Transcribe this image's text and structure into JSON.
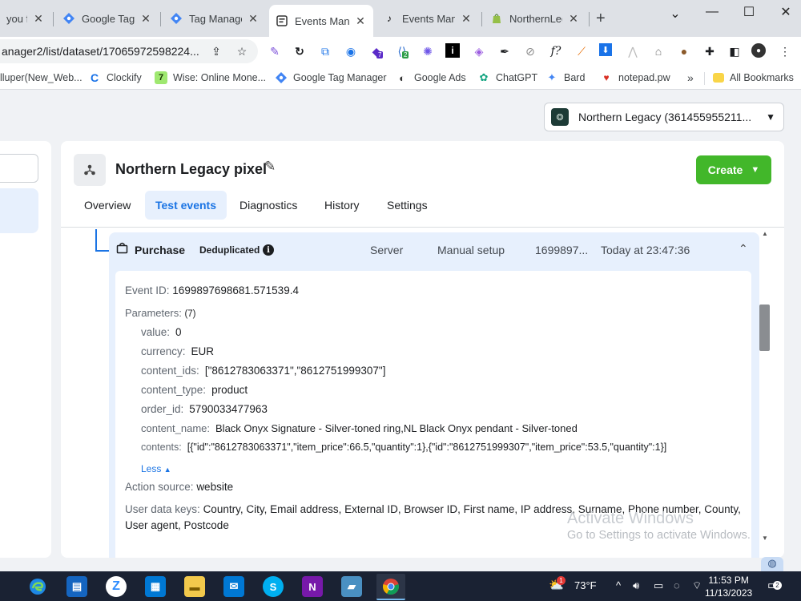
{
  "browser": {
    "tabs": [
      {
        "title": "you fo",
        "icon": "generic-page-icon"
      },
      {
        "title": "Google Tag M",
        "icon": "google-tag-manager-icon"
      },
      {
        "title": "Tag Manage",
        "icon": "google-tag-manager-icon"
      },
      {
        "title": "Events Mana",
        "icon": "events-manager-icon",
        "active": true
      },
      {
        "title": "Events Mana",
        "icon": "tiktok-icon"
      },
      {
        "title": "NorthernLeg",
        "icon": "shopify-icon"
      }
    ],
    "new_tab": "+",
    "address": "anager2/list/dataset/17065972598224...",
    "extension_badges": [
      "7",
      "2"
    ],
    "bookmarks": [
      {
        "label": "lluper(New_Web...",
        "icon": "bookmark-page-icon"
      },
      {
        "label": "Clockify",
        "icon": "clockify-icon"
      },
      {
        "label": "Wise: Online Mone...",
        "icon": "wise-icon"
      },
      {
        "label": "Google Tag Manager",
        "icon": "google-tag-manager-icon"
      },
      {
        "label": "Google Ads",
        "icon": "google-ads-icon"
      },
      {
        "label": "ChatGPT",
        "icon": "chatgpt-icon"
      },
      {
        "label": "Bard",
        "icon": "bard-icon"
      },
      {
        "label": "notepad.pw",
        "icon": "notepad-icon"
      }
    ],
    "bookmarks_overflow": "»",
    "all_bookmarks": "All Bookmarks"
  },
  "page": {
    "account_name": "Northern Legacy (361455955211...",
    "pixel_name": "Northern Legacy pixel",
    "create_label": "Create",
    "tabs": [
      "Overview",
      "Test events",
      "Diagnostics",
      "History",
      "Settings"
    ],
    "active_tab": "Test events",
    "event": {
      "name": "Purchase",
      "badge": "Deduplicated",
      "source": "Server",
      "setup": "Manual setup",
      "id_short": "1699897...",
      "time": "Today at 23:47:36",
      "event_id_label": "Event ID:",
      "event_id": "1699897698681.571539.4",
      "parameters_label": "Parameters:",
      "parameters_count": "(7)",
      "parameters": [
        {
          "key": "value:",
          "value": "0"
        },
        {
          "key": "currency:",
          "value": "EUR"
        },
        {
          "key": "content_ids:",
          "value": "[\"8612783063371\",\"8612751999307\"]"
        },
        {
          "key": "content_type:",
          "value": "product"
        },
        {
          "key": "order_id:",
          "value": "5790033477963"
        },
        {
          "key": "content_name:",
          "value": "Black Onyx Signature - Silver-toned ring,NL Black Onyx pendant - Silver-toned"
        },
        {
          "key": "contents:",
          "value": "[{\"id\":\"8612783063371\",\"item_price\":66.5,\"quantity\":1},{\"id\":\"8612751999307\",\"item_price\":53.5,\"quantity\":1}]"
        }
      ],
      "less_label": "Less",
      "action_source_label": "Action source:",
      "action_source": "website",
      "user_data_label": "User data keys:",
      "user_data_line1": "Country, City, Email address, External ID, Browser ID, First name, IP address, Surname, Phone number, County,",
      "user_data_line2": "User agent, Postcode"
    },
    "watermark_title": "Activate Windows",
    "watermark_sub": "Go to Settings to activate Windows."
  },
  "taskbar": {
    "temperature": "73°F",
    "time": "11:53 PM",
    "date": "11/13/2023",
    "notifications": "2",
    "weather_badge": "1"
  },
  "colors": {
    "accent_blue": "#1b74e4",
    "create_green": "#42b72a",
    "selected_bg": "#e7f0fd"
  }
}
